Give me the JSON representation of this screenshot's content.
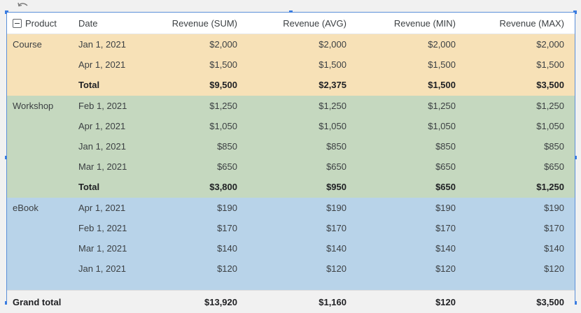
{
  "header": {
    "product": "Product",
    "date": "Date",
    "sum": "Revenue (SUM)",
    "avg": "Revenue (AVG)",
    "min": "Revenue (MIN)",
    "max": "Revenue (MAX)"
  },
  "groups": [
    {
      "product": "Course",
      "color": "#f7e1b7",
      "rows": [
        {
          "date": "Jan 1, 2021",
          "sum": "$2,000",
          "avg": "$2,000",
          "min": "$2,000",
          "max": "$2,000"
        },
        {
          "date": "Apr 1, 2021",
          "sum": "$1,500",
          "avg": "$1,500",
          "min": "$1,500",
          "max": "$1,500"
        }
      ],
      "total": {
        "label": "Total",
        "sum": "$9,500",
        "avg": "$2,375",
        "min": "$1,500",
        "max": "$3,500"
      }
    },
    {
      "product": "Workshop",
      "color": "#c5d8bf",
      "rows": [
        {
          "date": "Feb 1, 2021",
          "sum": "$1,250",
          "avg": "$1,250",
          "min": "$1,250",
          "max": "$1,250"
        },
        {
          "date": "Apr 1, 2021",
          "sum": "$1,050",
          "avg": "$1,050",
          "min": "$1,050",
          "max": "$1,050"
        },
        {
          "date": "Jan 1, 2021",
          "sum": "$850",
          "avg": "$850",
          "min": "$850",
          "max": "$850"
        },
        {
          "date": "Mar 1, 2021",
          "sum": "$650",
          "avg": "$650",
          "min": "$650",
          "max": "$650"
        }
      ],
      "total": {
        "label": "Total",
        "sum": "$3,800",
        "avg": "$950",
        "min": "$650",
        "max": "$1,250"
      }
    },
    {
      "product": "eBook",
      "color": "#b8d3e9",
      "rows": [
        {
          "date": "Apr 1, 2021",
          "sum": "$190",
          "avg": "$190",
          "min": "$190",
          "max": "$190"
        },
        {
          "date": "Feb 1, 2021",
          "sum": "$170",
          "avg": "$170",
          "min": "$170",
          "max": "$170"
        },
        {
          "date": "Mar 1, 2021",
          "sum": "$140",
          "avg": "$140",
          "min": "$140",
          "max": "$140"
        },
        {
          "date": "Jan 1, 2021",
          "sum": "$120",
          "avg": "$120",
          "min": "$120",
          "max": "$120"
        }
      ]
    }
  ],
  "grand_total": {
    "label": "Grand total",
    "sum": "$13,920",
    "avg": "$1,160",
    "min": "$120",
    "max": "$3,500"
  }
}
